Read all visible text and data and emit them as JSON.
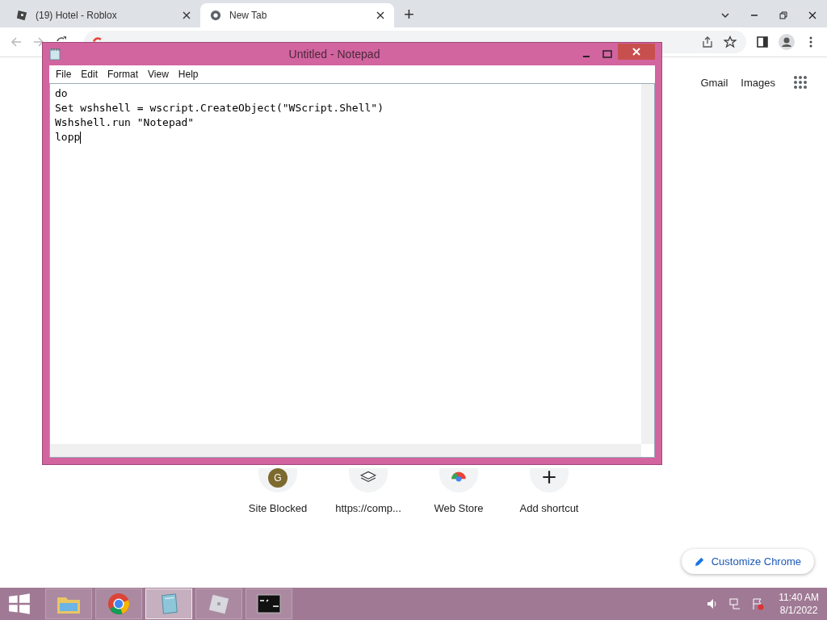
{
  "browser": {
    "tabs": [
      {
        "label": "(19) Hotel - Roblox",
        "selected": false,
        "kind": "roblox"
      },
      {
        "label": "New Tab",
        "selected": true,
        "kind": "chrome"
      }
    ],
    "new_tab_button": "+"
  },
  "new_tab_page": {
    "links": [
      "Gmail",
      "Images"
    ],
    "shortcuts": [
      {
        "label": "Site Blocked",
        "kind": "letter",
        "letter": "G"
      },
      {
        "label": "https://comp...",
        "kind": "site"
      },
      {
        "label": "Web Store",
        "kind": "store"
      },
      {
        "label": "Add shortcut",
        "kind": "add"
      }
    ],
    "customize_button": "Customize Chrome"
  },
  "notepad": {
    "title": "Untitled - Notepad",
    "menu": [
      "File",
      "Edit",
      "Format",
      "View",
      "Help"
    ],
    "lines": [
      "do",
      "Set wshshell = wscript.CreateObject(\"WScript.Shell\")",
      "Wshshell.run \"Notepad\"",
      "lopp"
    ]
  },
  "taskbar": {
    "apps": [
      {
        "kind": "explorer",
        "selected": false
      },
      {
        "kind": "chrome",
        "selected": false
      },
      {
        "kind": "notepad",
        "selected": true
      },
      {
        "kind": "roblox",
        "selected": false
      },
      {
        "kind": "cmd",
        "selected": false
      }
    ],
    "time": "11:40 AM",
    "date": "8/1/2022"
  }
}
